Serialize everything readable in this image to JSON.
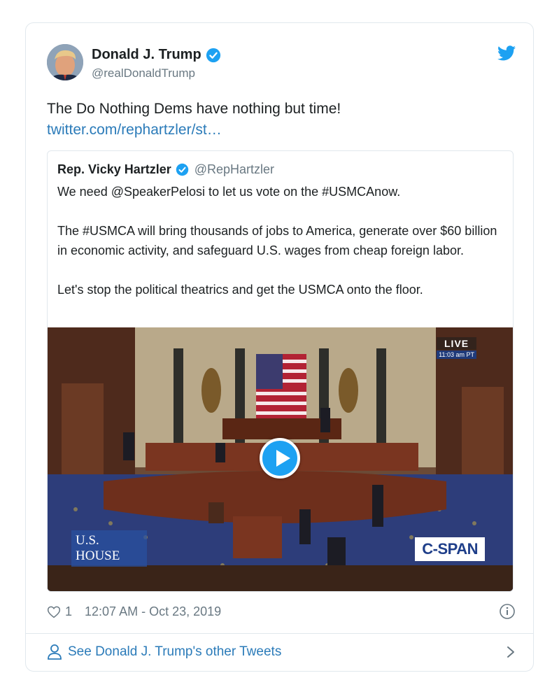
{
  "author": {
    "name": "Donald J. Trump",
    "handle": "@realDonaldTrump"
  },
  "tweet": {
    "text": "The Do Nothing Dems have nothing but time!",
    "link": "twitter.com/rephartzler/st…"
  },
  "quoted": {
    "name": "Rep. Vicky Hartzler",
    "handle": "@RepHartzler",
    "paragraphs": [
      "We need @SpeakerPelosi to let us vote on the #USMCAnow.",
      "The #USMCA will bring thousands of jobs to America, generate over $60 billion in economic activity, and safeguard U.S. wages from cheap foreign labor.",
      "Let's stop the political theatrics and get the USMCA onto the floor."
    ],
    "media": {
      "live_label": "LIVE",
      "live_time": "11:03 am PT",
      "house_logo_line1": "U.S.",
      "house_logo_line2": "HOUSE",
      "network_logo": "C-SPAN"
    }
  },
  "footer": {
    "like_count": "1",
    "timestamp": "12:07 AM - Oct 23, 2019"
  },
  "see_more": {
    "label": "See Donald J. Trump's other Tweets"
  },
  "icons": {
    "verified": "verified-badge-icon",
    "bird": "twitter-bird-icon",
    "heart": "heart-icon",
    "info": "info-icon",
    "person": "person-icon",
    "chevron": "chevron-right-icon"
  },
  "colors": {
    "twitter_blue": "#1da1f2",
    "link_blue": "#2b7bb9",
    "muted_text": "#697882",
    "border": "#e1e8ed"
  }
}
